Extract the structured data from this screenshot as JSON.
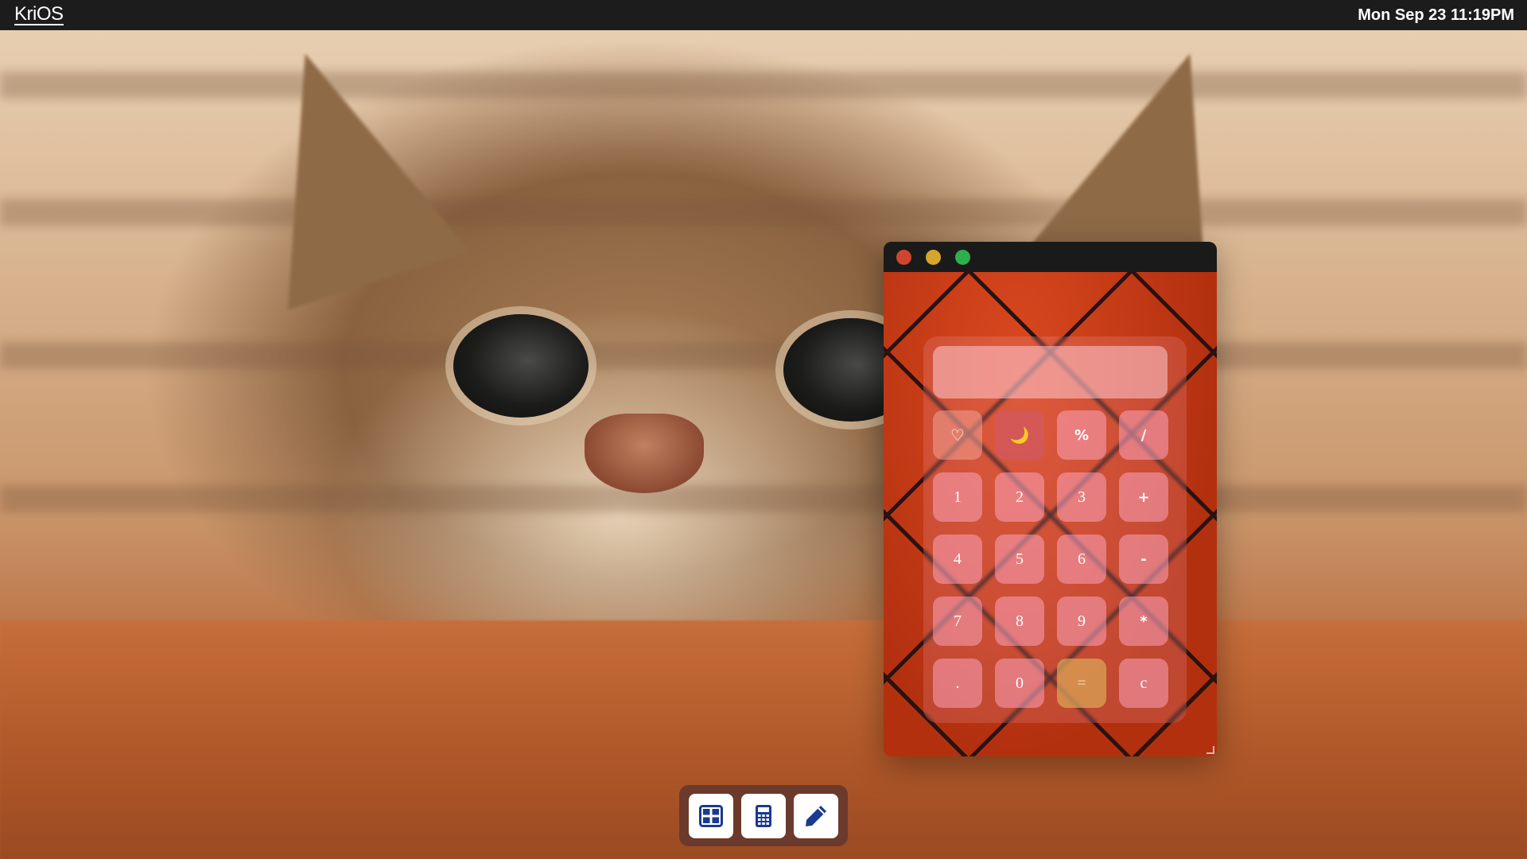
{
  "menubar": {
    "logo": "KriOS",
    "clock": "Mon Sep 23 11:19PM"
  },
  "calculator": {
    "display_value": "",
    "keys": [
      {
        "label": "♡",
        "name": "key-heart-theme"
      },
      {
        "label": "🌙",
        "name": "key-moon-theme"
      },
      {
        "label": "%",
        "name": "key-percent"
      },
      {
        "label": "/",
        "name": "key-divide"
      },
      {
        "label": "1",
        "name": "key-1"
      },
      {
        "label": "2",
        "name": "key-2"
      },
      {
        "label": "3",
        "name": "key-3"
      },
      {
        "label": "+",
        "name": "key-plus"
      },
      {
        "label": "4",
        "name": "key-4"
      },
      {
        "label": "5",
        "name": "key-5"
      },
      {
        "label": "6",
        "name": "key-6"
      },
      {
        "label": "-",
        "name": "key-minus"
      },
      {
        "label": "7",
        "name": "key-7"
      },
      {
        "label": "8",
        "name": "key-8"
      },
      {
        "label": "9",
        "name": "key-9"
      },
      {
        "label": "*",
        "name": "key-multiply"
      },
      {
        "label": ".",
        "name": "key-decimal"
      },
      {
        "label": "0",
        "name": "key-0"
      },
      {
        "label": "=",
        "name": "key-equals"
      },
      {
        "label": "c",
        "name": "key-clear"
      }
    ],
    "window_controls": [
      "close",
      "minimize",
      "maximize"
    ]
  },
  "dock": {
    "items": [
      {
        "icon": "grid-icon",
        "name": "dock-grid-app"
      },
      {
        "icon": "calculator-icon",
        "name": "dock-calculator-app"
      },
      {
        "icon": "pencil-icon",
        "name": "dock-pencil-app"
      }
    ]
  },
  "colors": {
    "menubar": "#1c1c1c",
    "dock_bg": "#6b3a2c",
    "dock_icon": "#1a3a8f",
    "close": "#d0452f",
    "minimize": "#d4a72c",
    "maximize": "#2fae4a"
  }
}
